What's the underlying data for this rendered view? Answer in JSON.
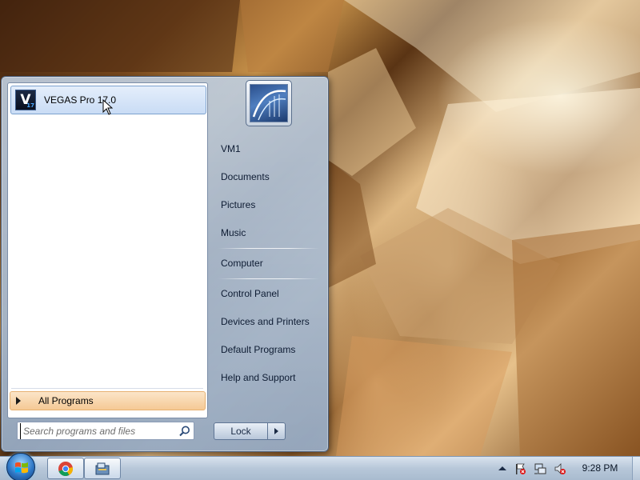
{
  "start_menu": {
    "pinned_program": {
      "label": "VEGAS Pro 17.0",
      "icon_letter": "V",
      "icon_version": "17",
      "icon": "vegas-pro-icon"
    },
    "all_programs_label": "All Programs",
    "search": {
      "placeholder": "Search programs and files",
      "value": ""
    },
    "user_picture_icon": "user-picture-icon",
    "right_items": [
      {
        "label": "VM1"
      },
      {
        "label": "Documents"
      },
      {
        "label": "Pictures"
      },
      {
        "label": "Music"
      },
      {
        "label": "Computer"
      },
      {
        "label": "Control Panel"
      },
      {
        "label": "Devices and Printers"
      },
      {
        "label": "Default Programs"
      },
      {
        "label": "Help and Support"
      }
    ],
    "lock_label": "Lock"
  },
  "taskbar": {
    "pinned": [
      {
        "icon": "chrome-icon"
      },
      {
        "icon": "file-manager-icon"
      }
    ],
    "tray_icons": [
      "show-hidden-icons-icon",
      "action-center-icon",
      "network-icon",
      "volume-muted-icon"
    ],
    "clock": "9:28 PM"
  },
  "colors": {
    "menu_highlight": "#c9dcf5",
    "all_programs_highlight": "#f5c995",
    "taskbar": "#b7c7d9"
  }
}
